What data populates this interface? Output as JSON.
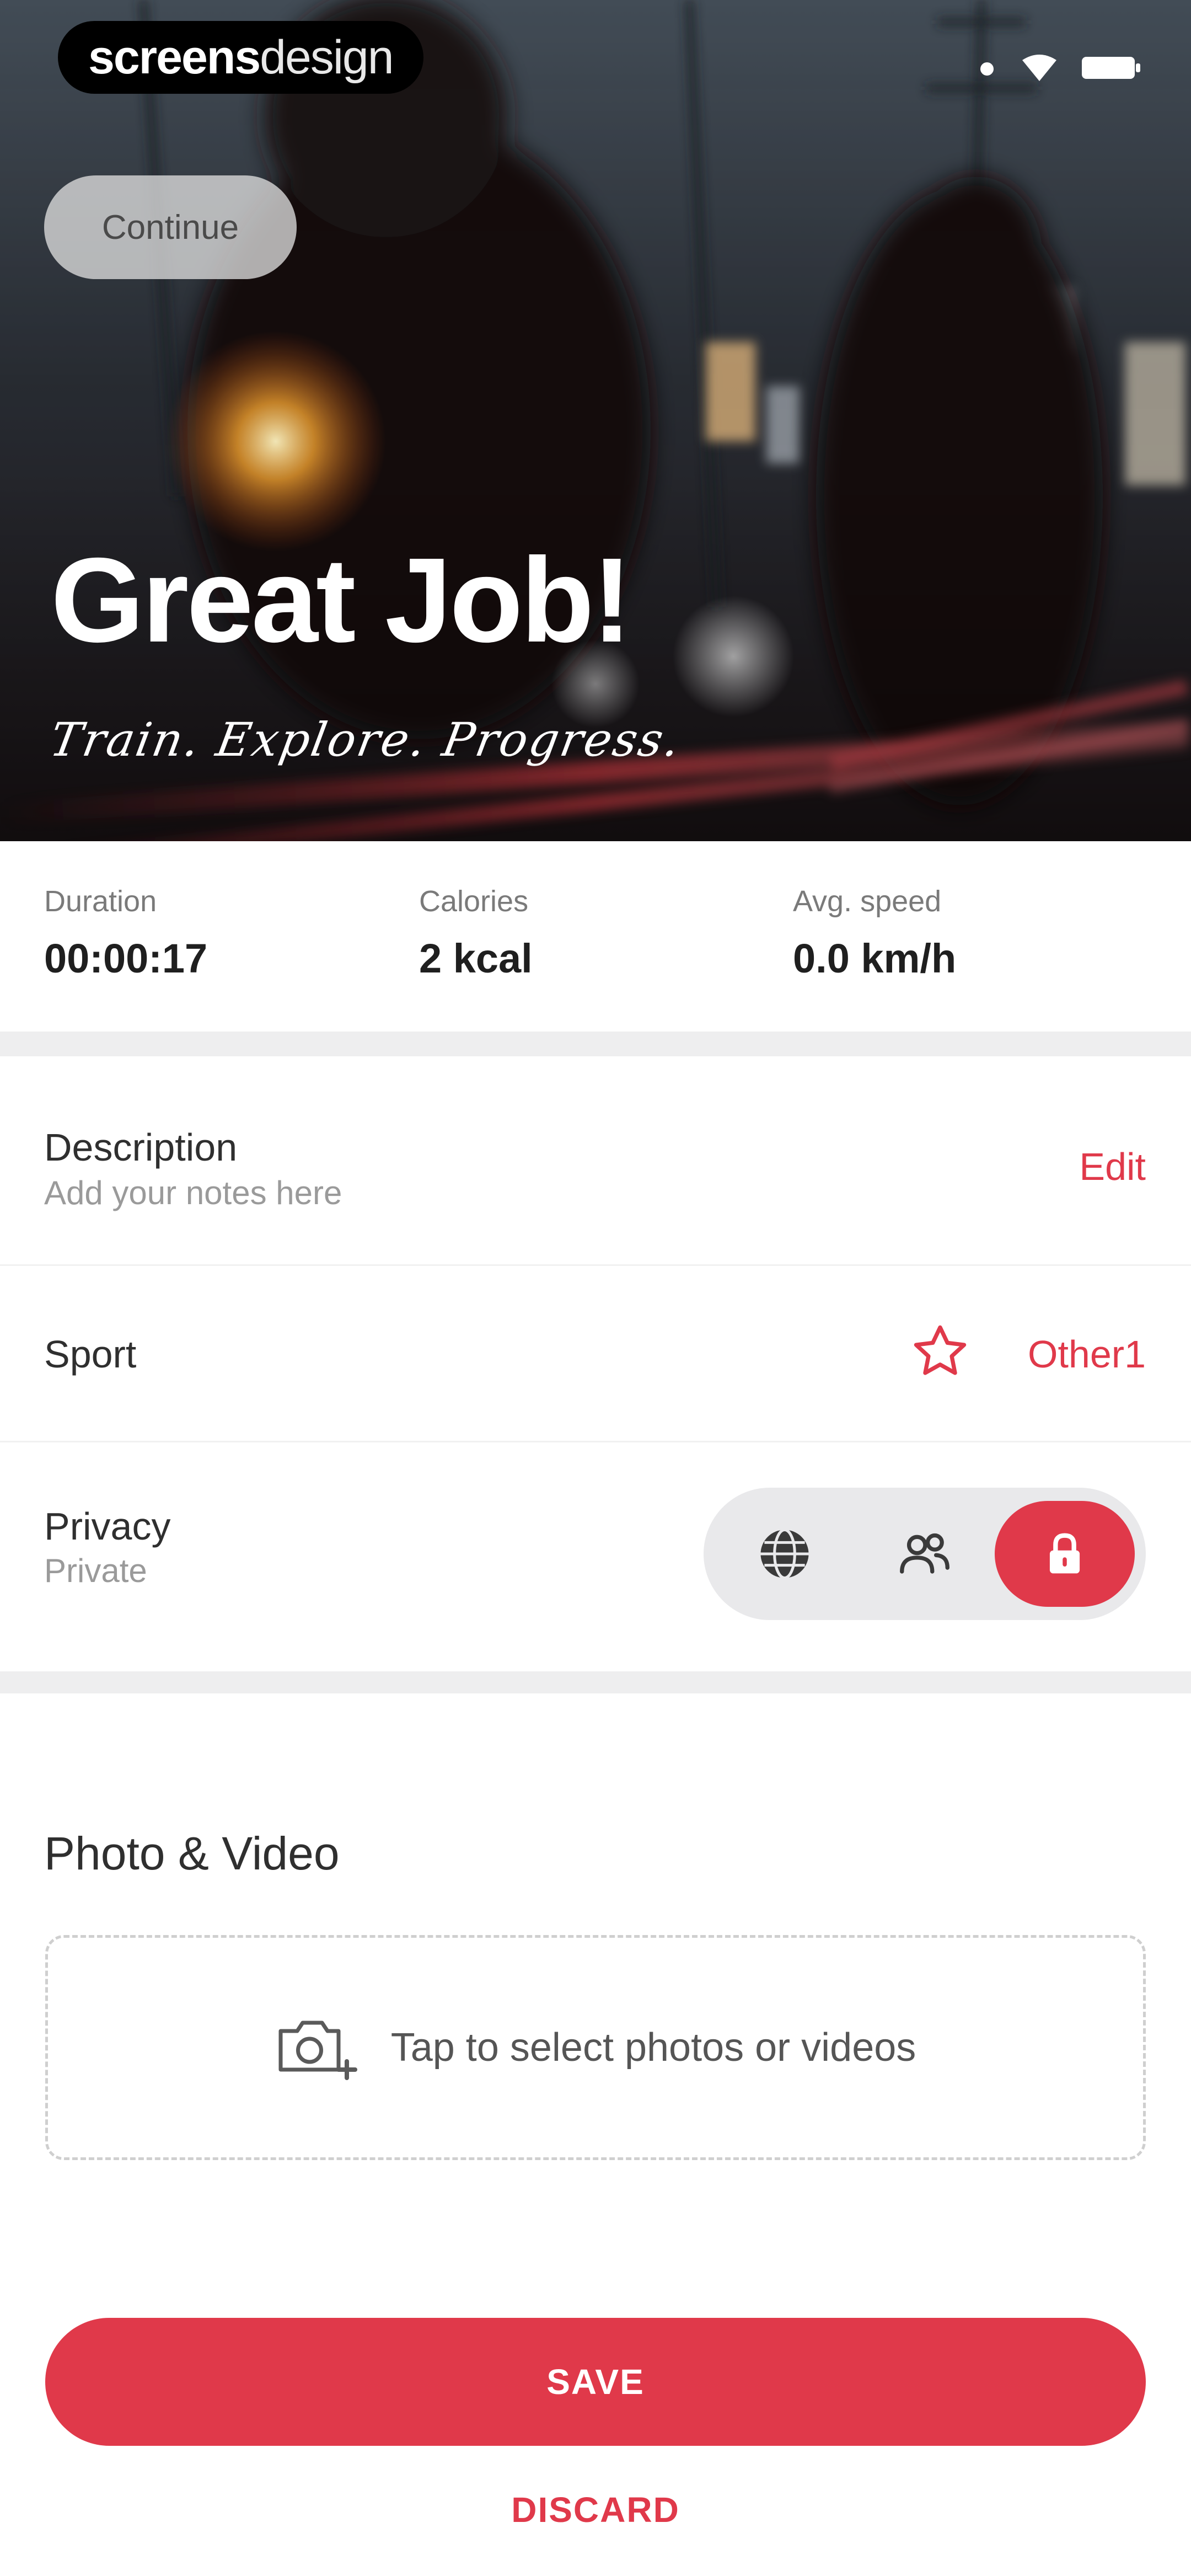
{
  "brand": {
    "part1": "screens",
    "part2": "design"
  },
  "hero": {
    "continue_label": "Continue",
    "title": "Great Job!",
    "tagline": "Train. Explore. Progress."
  },
  "stats": [
    {
      "label": "Duration",
      "value": "00:00:17"
    },
    {
      "label": "Calories",
      "value": "2 kcal"
    },
    {
      "label": "Avg. speed",
      "value": "0.0 km/h"
    }
  ],
  "description": {
    "title": "Description",
    "placeholder": "Add your notes here",
    "action": "Edit"
  },
  "sport": {
    "title": "Sport",
    "value": "Other1",
    "icon": "star-icon"
  },
  "privacy": {
    "title": "Privacy",
    "value": "Private",
    "options": [
      "globe-icon",
      "people-icon",
      "lock-icon"
    ],
    "selected": "lock-icon"
  },
  "media": {
    "title": "Photo & Video",
    "prompt": "Tap to select photos or videos",
    "icon": "camera-add-icon"
  },
  "actions": {
    "save": "SAVE",
    "discard": "DISCARD"
  },
  "colors": {
    "accent": "#e0394a",
    "toggle_bg": "#e9e9eb",
    "section_gap": "#eeeeef"
  }
}
